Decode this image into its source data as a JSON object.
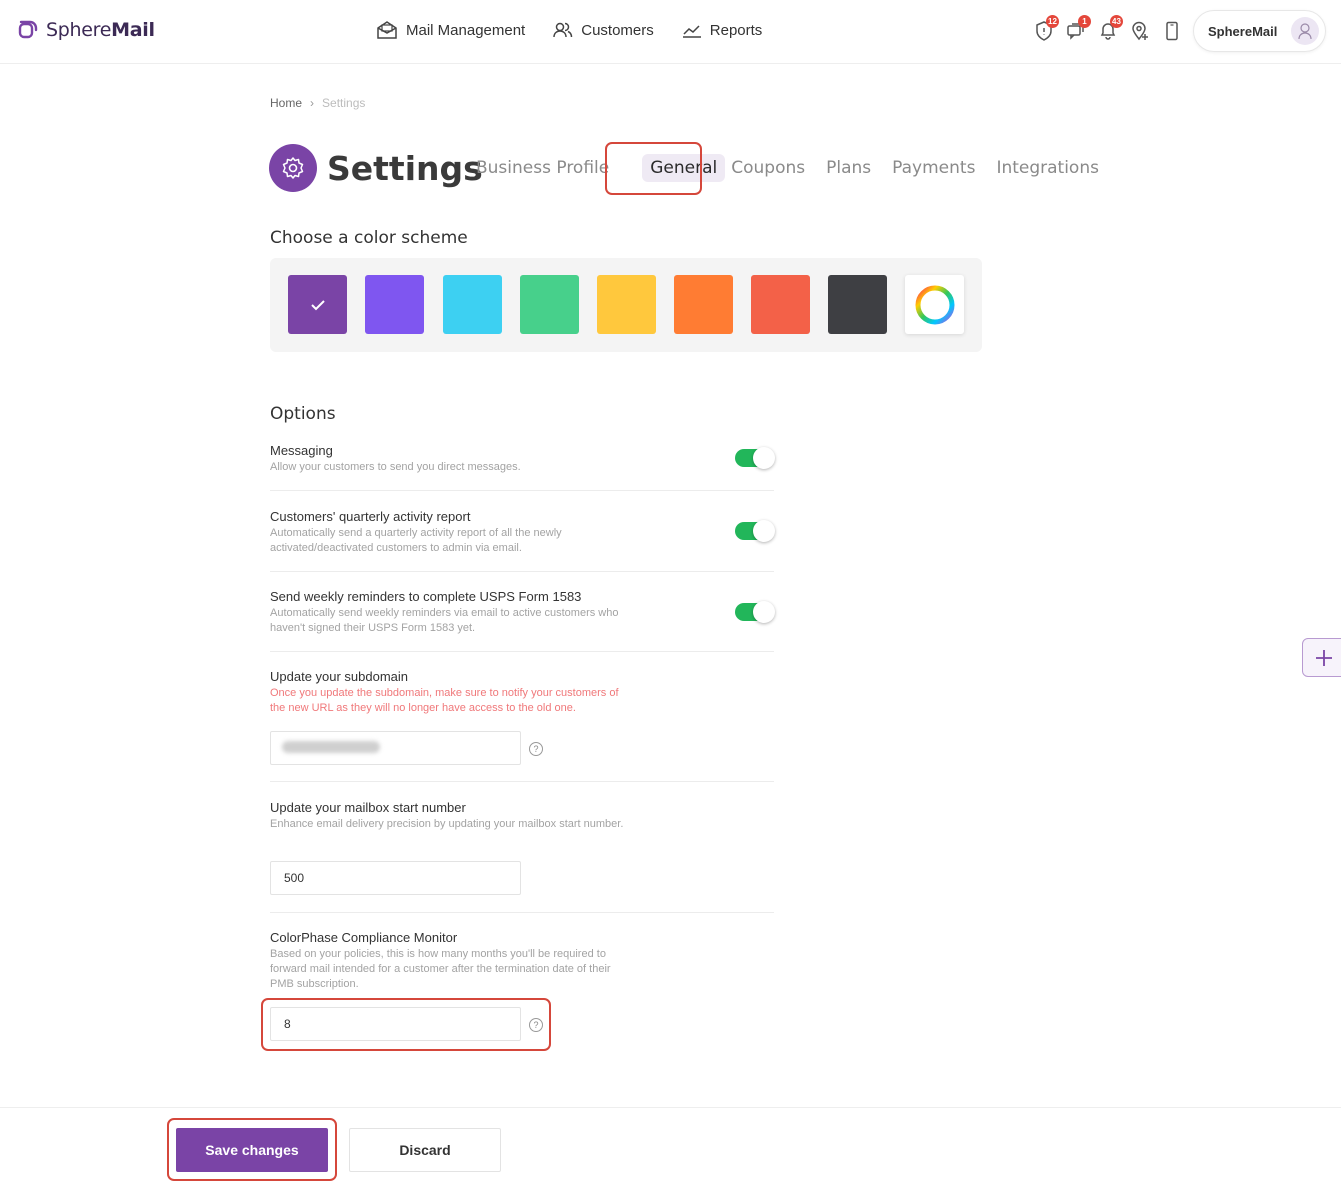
{
  "brand": {
    "name_light": "Sphere",
    "name_bold": "Mail",
    "color": "#7a44a6"
  },
  "nav": [
    {
      "label": "Mail Management",
      "icon": "mail-open-icon"
    },
    {
      "label": "Customers",
      "icon": "users-icon"
    },
    {
      "label": "Reports",
      "icon": "chart-line-icon"
    }
  ],
  "header_icons": [
    {
      "icon": "shield-alert-icon",
      "badge": "12"
    },
    {
      "icon": "chat-icon",
      "badge": "1"
    },
    {
      "icon": "bell-icon",
      "badge": "43"
    },
    {
      "icon": "location-pin-icon",
      "badge": ""
    },
    {
      "icon": "mobile-icon",
      "badge": ""
    }
  ],
  "user": {
    "name": "SphereMail"
  },
  "breadcrumb": {
    "home": "Home",
    "separator": "›",
    "current": "Settings"
  },
  "page": {
    "title": "Settings"
  },
  "tabs": [
    {
      "label": "Business Profile",
      "active": false
    },
    {
      "label": "General",
      "active": true
    },
    {
      "label": "Coupons",
      "active": false
    },
    {
      "label": "Plans",
      "active": false
    },
    {
      "label": "Payments",
      "active": false
    },
    {
      "label": "Integrations",
      "active": false
    }
  ],
  "color_scheme": {
    "title": "Choose a color scheme",
    "colors": [
      "#7a44a6",
      "#7f56f0",
      "#3dd0f2",
      "#47d08b",
      "#ffc83d",
      "#ff7c33",
      "#f36148",
      "#3e3f43"
    ],
    "selected_index": 0,
    "custom_icon": "color-wheel-icon"
  },
  "options": {
    "title": "Options",
    "messaging": {
      "title": "Messaging",
      "desc": "Allow your customers to send you direct messages.",
      "enabled": true
    },
    "quarterly": {
      "title": "Customers' quarterly activity report",
      "desc": "Automatically send a quarterly activity report of all the newly activated/deactivated customers to admin via email.",
      "enabled": true
    },
    "weekly": {
      "title": "Send weekly reminders to complete USPS Form 1583",
      "desc": "Automatically send weekly reminders via email to active customers who haven't signed their USPS Form 1583 yet.",
      "enabled": true
    },
    "subdomain": {
      "title": "Update your subdomain",
      "desc": "Once you update the subdomain, make sure to notify your customers of the new URL as they will no longer have access to the old one.",
      "value": ""
    },
    "mailbox": {
      "title": "Update your mailbox start number",
      "desc": "Enhance email delivery precision by updating your mailbox start number.",
      "value": "500"
    },
    "compliance": {
      "title": "ColorPhase Compliance Monitor",
      "desc": "Based on your policies, this is how many months you'll be required to forward mail intended for a customer after the termination date of their PMB subscription.",
      "value": "8"
    }
  },
  "actions": {
    "save": "Save changes",
    "discard": "Discard"
  },
  "help_glyph": "?",
  "fab_glyph": "+"
}
